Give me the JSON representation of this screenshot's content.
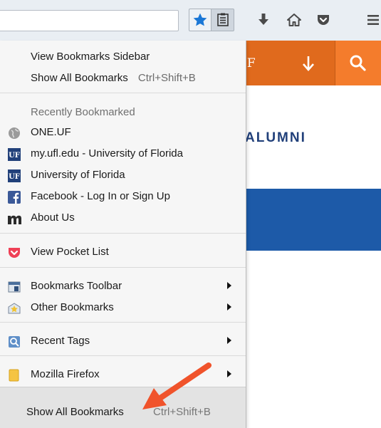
{
  "toolbar": {
    "url_value": "",
    "star_tooltip_icon": "star-icon",
    "bookmarks_menu_icon": "bookmarks-menu-icon",
    "download_icon": "download-icon",
    "home_icon": "home-icon",
    "pocket_icon": "pocket-icon",
    "menu_icon": "hamburger-menu-icon",
    "accent_color": "#1a77d6"
  },
  "page": {
    "uf_partial": "JF",
    "alumni_text": "ALUMNI",
    "orange_color": "#e06a1d",
    "blue_color": "#1d5aa8"
  },
  "menu": {
    "view_sidebar": "View Bookmarks Sidebar",
    "show_all": "Show All Bookmarks",
    "show_all_shortcut": "Ctrl+Shift+B",
    "recent_heading": "Recently Bookmarked",
    "recent": [
      {
        "label": "ONE.UF",
        "icon": "globe-icon"
      },
      {
        "label": "my.ufl.edu - University of Florida",
        "icon": "uf-icon"
      },
      {
        "label": "University of Florida",
        "icon": "uf-icon"
      },
      {
        "label": "Facebook - Log In or Sign Up",
        "icon": "facebook-icon"
      },
      {
        "label": "About Us",
        "icon": "m-logo-icon"
      }
    ],
    "pocket_list": "View Pocket List",
    "bookmarks_toolbar": "Bookmarks Toolbar",
    "other_bookmarks": "Other Bookmarks",
    "recent_tags": "Recent Tags",
    "mozilla_firefox": "Mozilla Firefox",
    "footer_label": "Show All Bookmarks",
    "footer_shortcut": "Ctrl+Shift+B",
    "uf_badge": "UF"
  }
}
